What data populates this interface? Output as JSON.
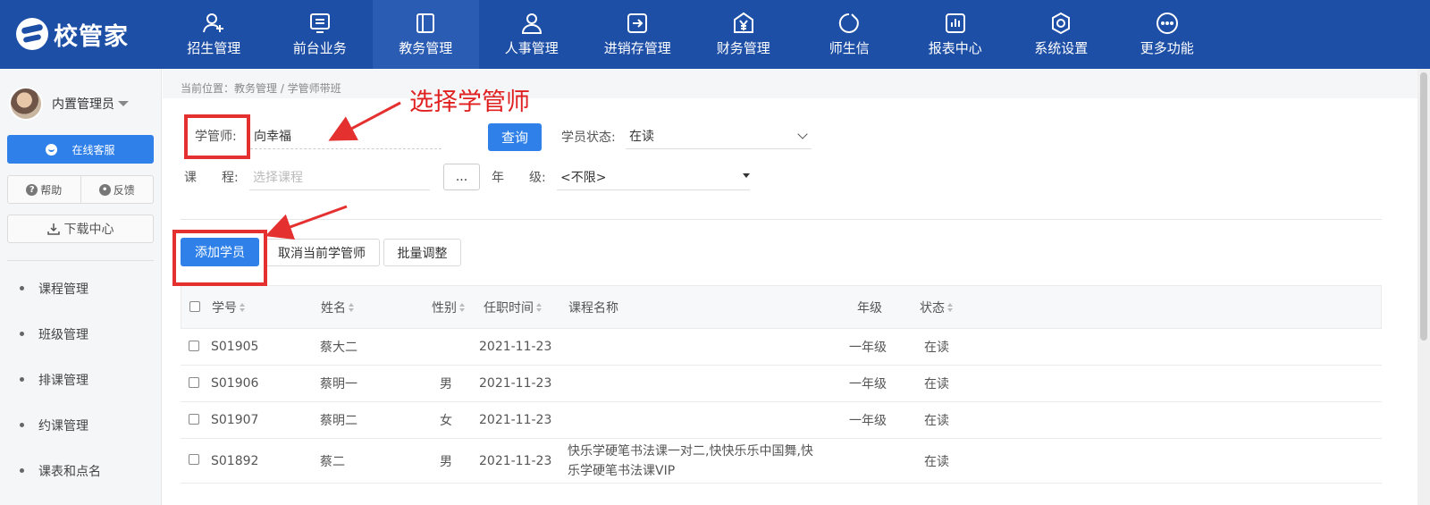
{
  "app": {
    "logo_text": "校管家"
  },
  "nav": {
    "items": [
      {
        "label": "招生管理",
        "icon": "user-plus-icon"
      },
      {
        "label": "前台业务",
        "icon": "monitor-icon"
      },
      {
        "label": "教务管理",
        "icon": "book-icon",
        "active": true
      },
      {
        "label": "人事管理",
        "icon": "person-icon"
      },
      {
        "label": "进销存管理",
        "icon": "export-icon"
      },
      {
        "label": "财务管理",
        "icon": "yen-icon"
      },
      {
        "label": "师生信",
        "icon": "chat-icon"
      },
      {
        "label": "报表中心",
        "icon": "chart-icon"
      },
      {
        "label": "系统设置",
        "icon": "gear-icon"
      },
      {
        "label": "更多功能",
        "icon": "more-icon"
      }
    ]
  },
  "sidebar": {
    "username": "内置管理员",
    "service_label": "在线客服",
    "help_label": "帮助",
    "feedback_label": "反馈",
    "download_label": "下载中心",
    "menu": [
      "课程管理",
      "班级管理",
      "排课管理",
      "约课管理",
      "课表和点名"
    ]
  },
  "breadcrumb": "当前位置：教务管理 / 学管师带班",
  "annotation": {
    "title": "选择学管师"
  },
  "filters": {
    "teacher_label": "学管师:",
    "teacher_value": "向幸福",
    "query_label": "查询",
    "status_label": "学员状态:",
    "status_value": "在读",
    "course_label_1": "课",
    "course_label_2": "程:",
    "course_placeholder": "选择课程",
    "dots_label": "...",
    "grade_label_1": "年",
    "grade_label_2": "级:",
    "grade_value": "<不限>"
  },
  "actions": {
    "add_label": "添加学员",
    "cancel_label": "取消当前学管师",
    "batch_label": "批量调整"
  },
  "table": {
    "headers": {
      "id": "学号",
      "name": "姓名",
      "gender": "性别",
      "date": "任职时间",
      "course": "课程名称",
      "grade": "年级",
      "status": "状态"
    },
    "rows": [
      {
        "id": "S01905",
        "name": "蔡大二",
        "gender": "",
        "date": "2021-11-23",
        "course_1": "",
        "course_2": "",
        "grade": "一年级",
        "status": "在读"
      },
      {
        "id": "S01906",
        "name": "蔡明一",
        "gender": "男",
        "date": "2021-11-23",
        "course_1": "",
        "course_2": "",
        "grade": "一年级",
        "status": "在读"
      },
      {
        "id": "S01907",
        "name": "蔡明二",
        "gender": "女",
        "date": "2021-11-23",
        "course_1": "",
        "course_2": "",
        "grade": "一年级",
        "status": "在读"
      },
      {
        "id": "S01892",
        "name": "蔡二",
        "gender": "男",
        "date": "2021-11-23",
        "course_1": "快乐学硬笔书法课一对二,快快乐乐中国舞,快",
        "course_2": "乐学硬笔书法课VIP",
        "grade": "",
        "status": "在读"
      }
    ]
  },
  "colors": {
    "header_bg": "#1e4fa6",
    "primary": "#2f80e8",
    "annotation": "#e02020"
  }
}
